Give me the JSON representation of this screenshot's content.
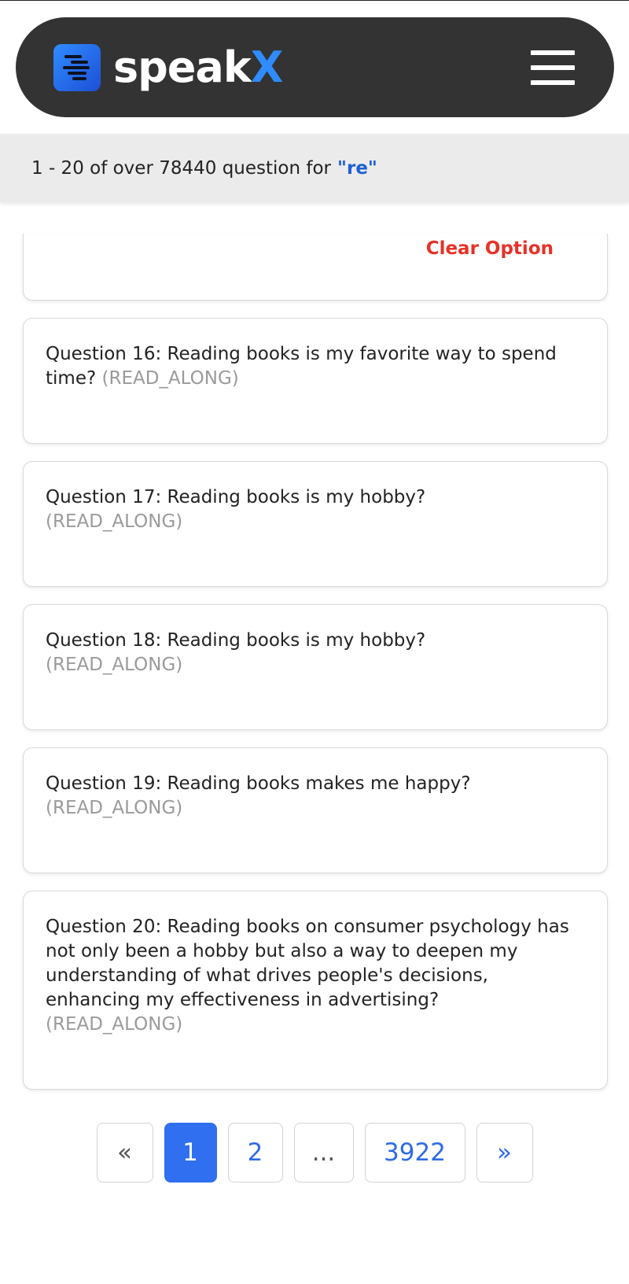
{
  "header": {
    "logo_text_main": "speak",
    "logo_text_accent": "X",
    "menu_icon": "hamburger-menu-icon"
  },
  "results": {
    "summary": "1 - 20 of over 78440 question for",
    "query": "\"re\""
  },
  "partial_card": {
    "clear_option_label": "Clear Option"
  },
  "questions": [
    {
      "text": "Question 16: Reading books is my favorite way to spend time?",
      "type": "(READ_ALONG)"
    },
    {
      "text": "Question 17: Reading books is my hobby?",
      "type": "(READ_ALONG)"
    },
    {
      "text": "Question 18: Reading books is my hobby?",
      "type": "(READ_ALONG)"
    },
    {
      "text": "Question 19: Reading books makes me happy?",
      "type": "(READ_ALONG)"
    },
    {
      "text": "Question 20: Reading books on consumer psychology has not only been a hobby but also a way to deepen my understanding of what drives people's decisions, enhancing my effectiveness in advertising?",
      "type": "(READ_ALONG)"
    }
  ],
  "pagination": {
    "prev": "«",
    "page1": "1",
    "page2": "2",
    "ellipsis": "...",
    "last": "3922",
    "next": "»",
    "active_page": "1"
  },
  "colors": {
    "header_bg": "#333333",
    "accent_blue": "#2f6ff0",
    "clear_red": "#e53228",
    "type_gray": "#9a9a9a"
  }
}
